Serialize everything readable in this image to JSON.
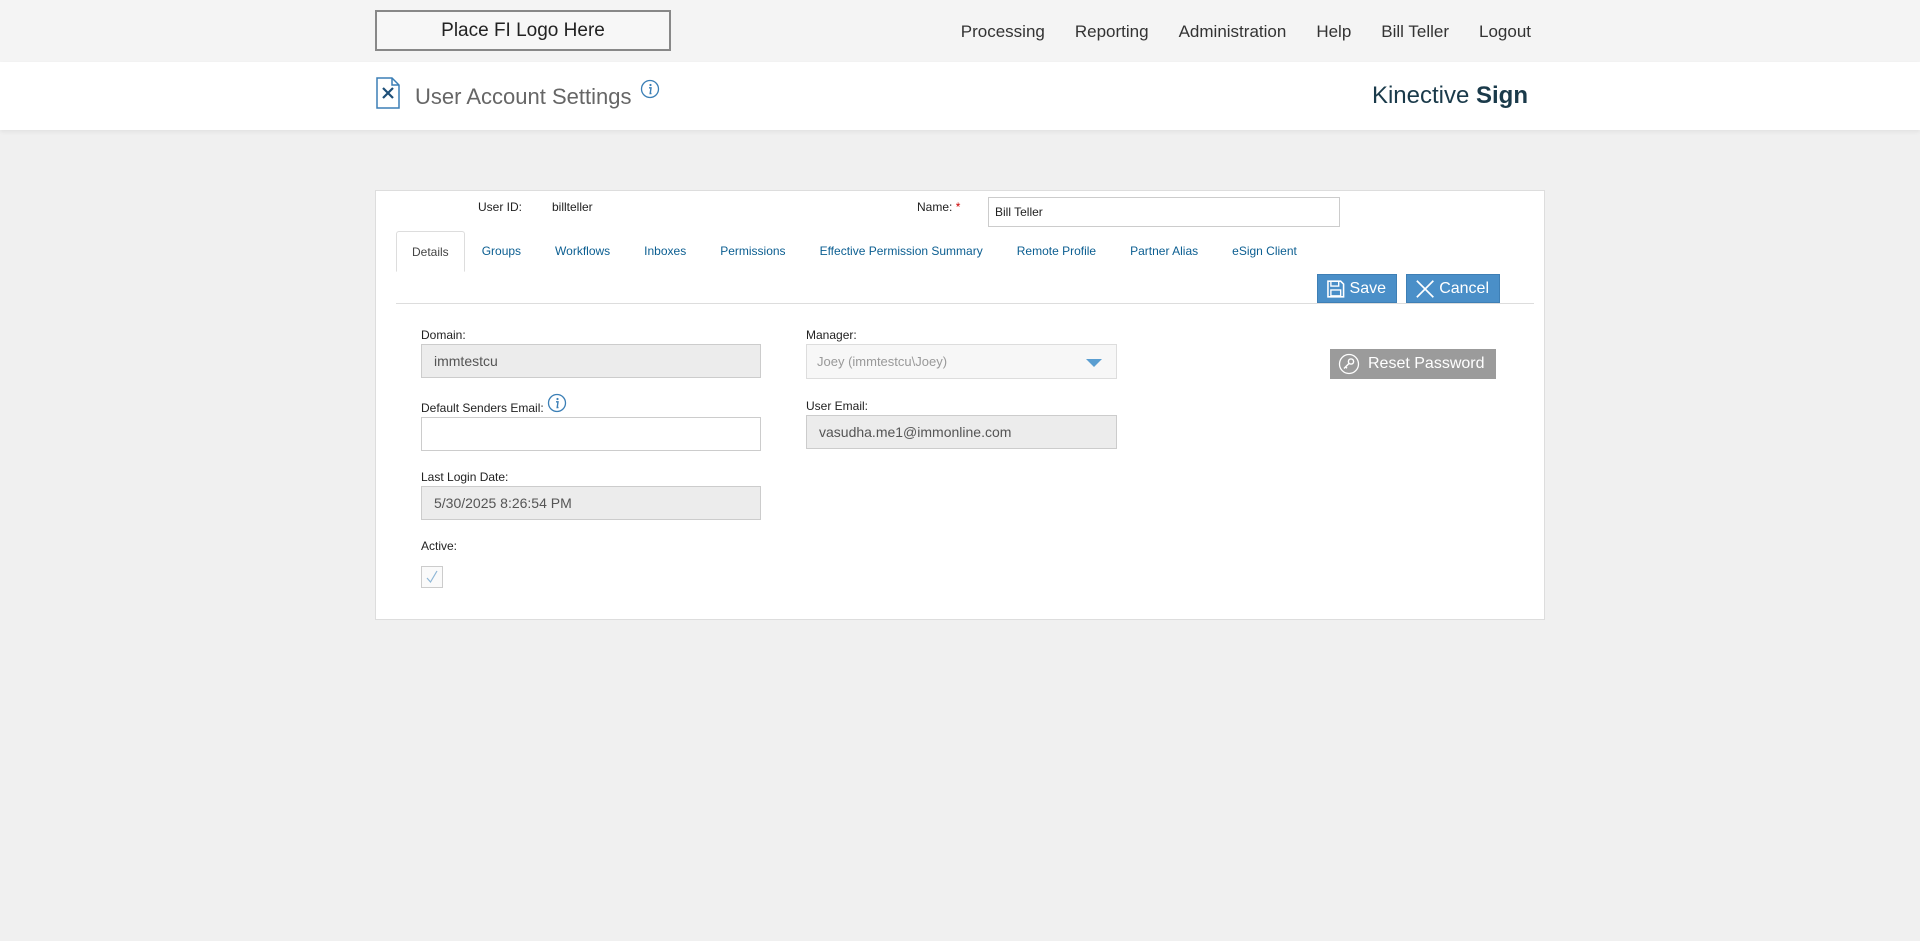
{
  "topbar": {
    "logo_text": "Place FI Logo Here",
    "nav": [
      "Processing",
      "Reporting",
      "Administration",
      "Help",
      "Bill Teller",
      "Logout"
    ]
  },
  "header": {
    "title": "User Account Settings",
    "brand_light": "Kinective ",
    "brand_bold": "Sign"
  },
  "user": {
    "user_id_label": "User ID:",
    "user_id": "billteller",
    "name_label": "Name:",
    "required_mark": "*",
    "name": "Bill Teller"
  },
  "tabs": [
    "Details",
    "Groups",
    "Workflows",
    "Inboxes",
    "Permissions",
    "Effective Permission Summary",
    "Remote Profile",
    "Partner Alias",
    "eSign Client"
  ],
  "active_tab": "Details",
  "buttons": {
    "save": "Save",
    "cancel": "Cancel",
    "reset_password": "Reset Password"
  },
  "form": {
    "domain_label": "Domain:",
    "domain": "immtestcu",
    "manager_label": "Manager:",
    "manager": "Joey (immtestcu\\Joey)",
    "default_email_label": "Default Senders Email:",
    "default_email": "",
    "user_email_label": "User Email:",
    "user_email": "vasudha.me1@immonline.com",
    "last_login_label": "Last Login Date:",
    "last_login": "5/30/2025 8:26:54 PM",
    "active_label": "Active:",
    "active": true
  },
  "colors": {
    "accent": "#4a8fc8",
    "link": "#0b5e91",
    "brand": "#1a3a4a"
  }
}
